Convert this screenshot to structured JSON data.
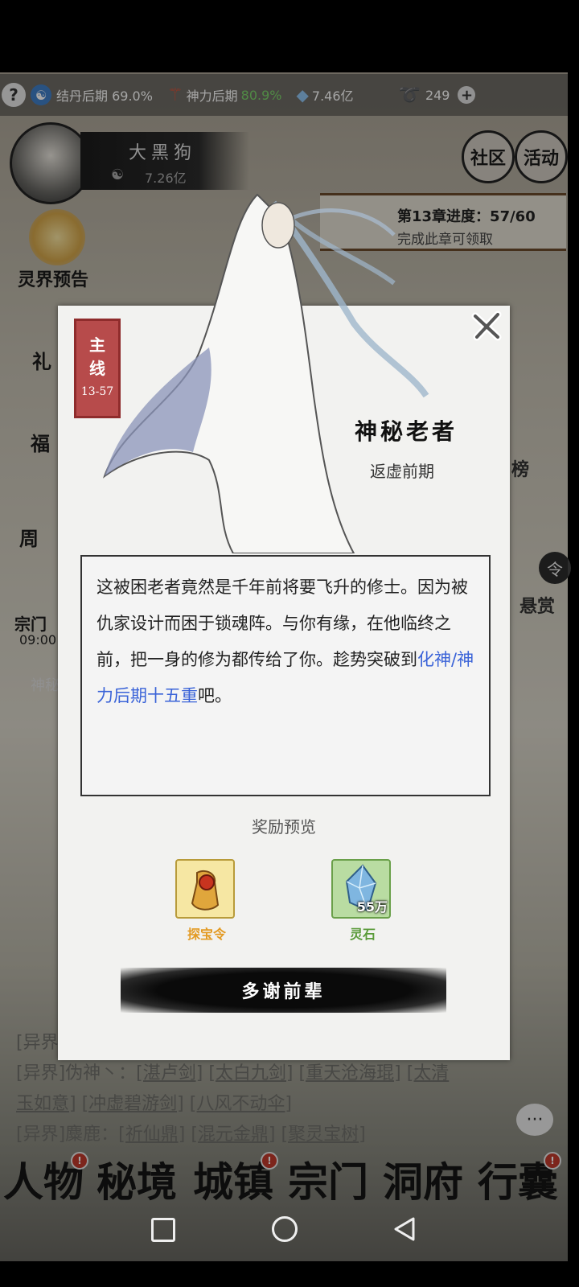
{
  "topbar": {
    "help": "?",
    "cultivation": "结丹后期 69.0%",
    "divine_label": "神力后期",
    "divine_pct": "80.9%",
    "spirit_stones": "7.46亿",
    "currency": "249",
    "plus": "+"
  },
  "player": {
    "name": "大黑狗",
    "power": "7.26亿"
  },
  "top_right": {
    "community": "社区",
    "activity": "活动"
  },
  "chapter": {
    "progress": "第13章进度：57/60",
    "hint": "完成此章可领取"
  },
  "side": {
    "realm_preview": "灵界预告",
    "gift": "礼",
    "welfare": "福",
    "weekly": "周",
    "sect": "宗门",
    "timer": "09:00",
    "secret": "神秘",
    "rank": "榜",
    "order": "令",
    "bounty": "悬赏"
  },
  "dialog": {
    "tag_line1": "主",
    "tag_line2": "线",
    "tag_stage": "13-57",
    "npc_name": "神秘老者",
    "npc_realm": "返虚前期",
    "text_part1": "这被困老者竟然是千年前将要飞升的修士。因为被仇家设计而困于锁魂阵。与你有缘，在他临终之前，把一身的修为都传给了你。趁势突破到",
    "text_highlight": "化神/神力后期十五重",
    "text_part2": "吧。",
    "reward_title": "奖励预览",
    "rewards": [
      {
        "name": "探宝令",
        "color": "#e39a22"
      },
      {
        "name": "灵石",
        "count": "55万",
        "color": "#5b9b3a"
      }
    ],
    "confirm": "多谢前辈"
  },
  "log": {
    "l1": "[异界",
    "l2_prefix": "[异界]伪神丶：",
    "l2_items": [
      "[湛卢剑]",
      "[太白九剑]",
      "[重天沧海琨]",
      "[太清"
    ],
    "l3_items": [
      "玉如意]",
      "[冲虚碧游剑]",
      "[八风不动伞]"
    ],
    "l4_prefix": "[异界]麋鹿：",
    "l4_items": [
      "[祈仙鼎]",
      "[混元金鼎]",
      "[聚灵宝树]"
    ]
  },
  "bottom_nav": [
    "人物",
    "秘境",
    "城镇",
    "宗门",
    "洞府",
    "行囊"
  ],
  "badge": "!",
  "colors": {
    "highlight": "#3a63d8",
    "divine_green": "#7bd36b",
    "tag_red": "#b74b4b"
  }
}
